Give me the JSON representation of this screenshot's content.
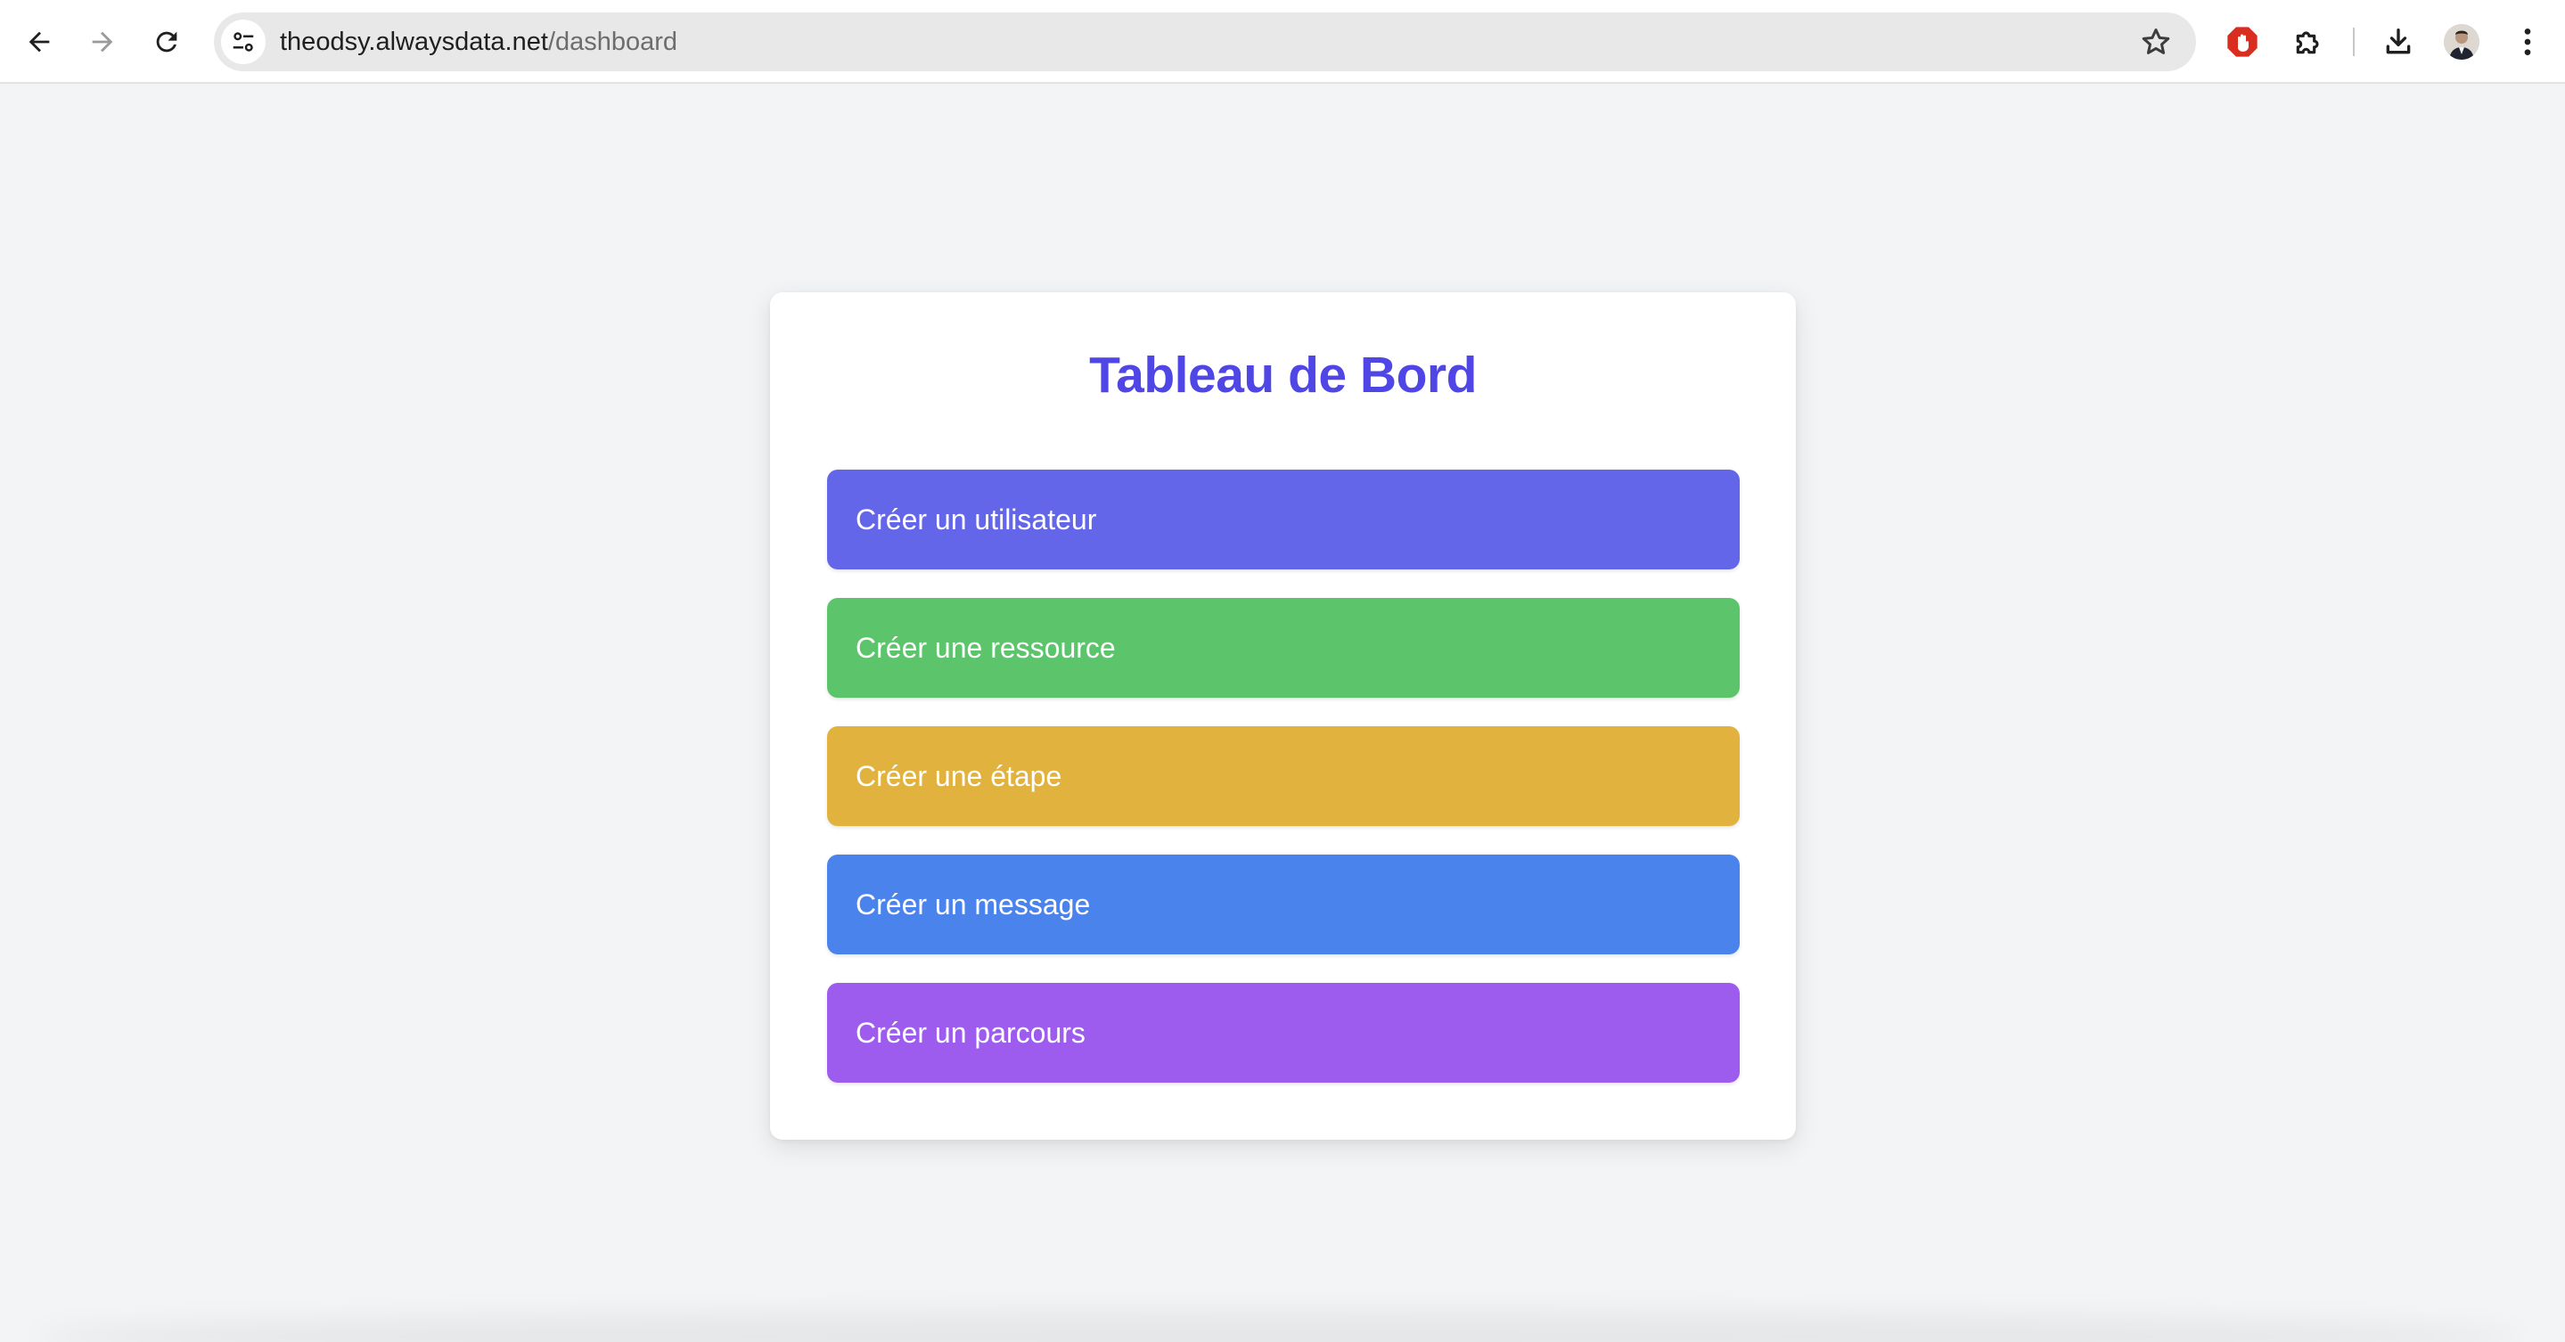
{
  "browser": {
    "url_host": "theodsy.alwaysdata.net",
    "url_path": "/dashboard",
    "icons": {
      "back": "arrow-left-icon",
      "forward": "arrow-right-icon",
      "reload": "reload-icon",
      "site_info": "tune-icon",
      "bookmark": "star-icon",
      "adblock": "stop-hand-icon",
      "extensions": "puzzle-icon",
      "downloads": "download-icon",
      "menu": "kebab-menu-icon"
    }
  },
  "dashboard": {
    "title": "Tableau de Bord",
    "title_color": "#4f46e5",
    "buttons": [
      {
        "label": "Créer un utilisateur",
        "color": "#6366e9"
      },
      {
        "label": "Créer une ressource",
        "color": "#5cc46b"
      },
      {
        "label": "Créer une étape",
        "color": "#e1b23d"
      },
      {
        "label": "Créer un message",
        "color": "#4b83ec"
      },
      {
        "label": "Créer un parcours",
        "color": "#9e5cee"
      }
    ]
  }
}
